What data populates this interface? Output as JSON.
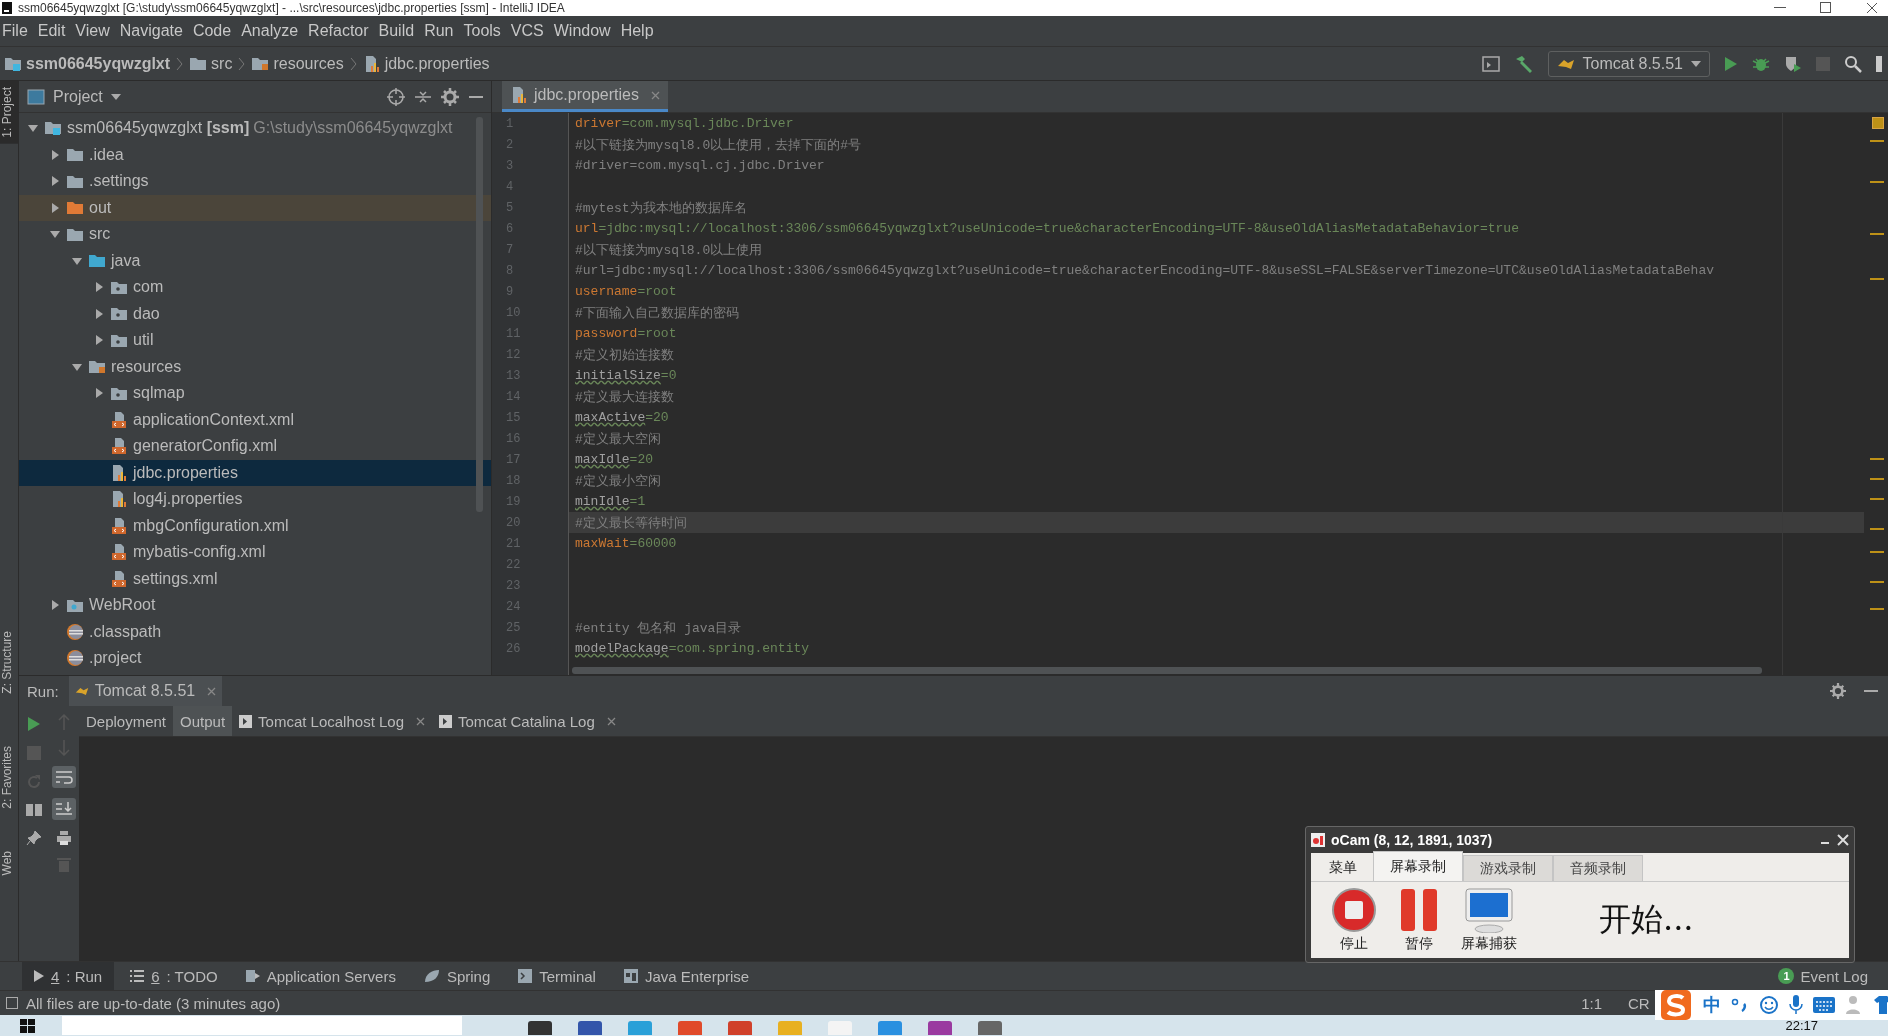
{
  "window": {
    "title": "ssm06645yqwzglxt [G:\\study\\ssm06645yqwzglxt] - ...\\src\\resources\\jdbc.properties [ssm] - IntelliJ IDEA"
  },
  "menu": [
    "File",
    "Edit",
    "View",
    "Navigate",
    "Code",
    "Analyze",
    "Refactor",
    "Build",
    "Run",
    "Tools",
    "VCS",
    "Window",
    "Help"
  ],
  "breadcrumb": [
    {
      "label": "ssm06645yqwzglxt",
      "kind": "module"
    },
    {
      "label": "src",
      "kind": "folder"
    },
    {
      "label": "resources",
      "kind": "resources"
    },
    {
      "label": "jdbc.properties",
      "kind": "properties"
    }
  ],
  "run_config": "Tomcat 8.5.51",
  "side_stripe": [
    {
      "label": "1: Project",
      "selected": true
    },
    {
      "label": "Z: Structure",
      "selected": false
    },
    {
      "label": "2: Favorites",
      "selected": false
    },
    {
      "label": "Web",
      "selected": false
    }
  ],
  "project": {
    "title": "Project",
    "tree": [
      {
        "name": "ssm06645yqwzglxt",
        "module": "[ssm]",
        "path": "G:\\study\\ssm06645yqwzglxt",
        "kind": "module",
        "expanded": true,
        "selected": false,
        "children": [
          {
            "name": ".idea",
            "kind": "folder",
            "expanded": false,
            "selected": false
          },
          {
            "name": ".settings",
            "kind": "folder",
            "expanded": false,
            "selected": false
          },
          {
            "name": "out",
            "kind": "excluded",
            "expanded": false,
            "selected": false
          },
          {
            "name": "src",
            "kind": "folder",
            "expanded": true,
            "selected": false,
            "children": [
              {
                "name": "java",
                "kind": "source",
                "expanded": true,
                "selected": false,
                "children": [
                  {
                    "name": "com",
                    "kind": "package",
                    "expanded": false,
                    "selected": false
                  },
                  {
                    "name": "dao",
                    "kind": "package",
                    "expanded": false,
                    "selected": false
                  },
                  {
                    "name": "util",
                    "kind": "package",
                    "expanded": false,
                    "selected": false
                  }
                ]
              },
              {
                "name": "resources",
                "kind": "resources",
                "expanded": true,
                "selected": false,
                "children": [
                  {
                    "name": "sqlmap",
                    "kind": "package",
                    "expanded": false,
                    "selected": false
                  },
                  {
                    "name": "applicationContext.xml",
                    "kind": "spring-xml",
                    "selected": false
                  },
                  {
                    "name": "generatorConfig.xml",
                    "kind": "xml",
                    "selected": false
                  },
                  {
                    "name": "jdbc.properties",
                    "kind": "properties",
                    "selected": true
                  },
                  {
                    "name": "log4j.properties",
                    "kind": "properties",
                    "selected": false
                  },
                  {
                    "name": "mbgConfiguration.xml",
                    "kind": "xml",
                    "selected": false
                  },
                  {
                    "name": "mybatis-config.xml",
                    "kind": "xml",
                    "selected": false
                  },
                  {
                    "name": "settings.xml",
                    "kind": "xml",
                    "selected": false
                  }
                ]
              }
            ]
          },
          {
            "name": "WebRoot",
            "kind": "web",
            "expanded": false,
            "selected": false
          },
          {
            "name": ".classpath",
            "kind": "eclipse",
            "selected": false
          },
          {
            "name": ".project",
            "kind": "eclipse",
            "selected": false
          }
        ]
      }
    ]
  },
  "editor": {
    "tab": "jdbc.properties",
    "lines": [
      {
        "n": "1",
        "kind": "property",
        "key": "driver",
        "value": "=com.mysql.jdbc.Driver",
        "unused": false,
        "current": false
      },
      {
        "n": "2",
        "kind": "comment",
        "text": "#以下链接为mysql8.0以上使用，去掉下面的#号",
        "current": false
      },
      {
        "n": "3",
        "kind": "comment",
        "text": "#driver=com.mysql.cj.jdbc.Driver",
        "current": false
      },
      {
        "n": "4",
        "kind": "blank",
        "current": false
      },
      {
        "n": "5",
        "kind": "comment",
        "text": "#mytest为我本地的数据库名",
        "current": false
      },
      {
        "n": "6",
        "kind": "property",
        "key": "url",
        "value": "=jdbc:mysql://localhost:3306/ssm06645yqwzglxt?useUnicode=true&characterEncoding=UTF-8&useOldAliasMetadataBehavior=true",
        "unused": false,
        "current": false
      },
      {
        "n": "7",
        "kind": "comment",
        "text": "#以下链接为mysql8.0以上使用",
        "current": false
      },
      {
        "n": "8",
        "kind": "comment",
        "text": "#url=jdbc:mysql://localhost:3306/ssm06645yqwzglxt?useUnicode=true&characterEncoding=UTF-8&useSSL=FALSE&serverTimezone=UTC&useOldAliasMetadataBehav",
        "current": false
      },
      {
        "n": "9",
        "kind": "property",
        "key": "username",
        "value": "=root",
        "unused": false,
        "current": false
      },
      {
        "n": "10",
        "kind": "comment",
        "text": "#下面输入自己数据库的密码",
        "current": false
      },
      {
        "n": "11",
        "kind": "property",
        "key": "password",
        "value": "=root",
        "unused": false,
        "current": false
      },
      {
        "n": "12",
        "kind": "comment",
        "text": "#定义初始连接数",
        "current": false
      },
      {
        "n": "13",
        "kind": "property",
        "key": "initialSize",
        "value": "=0",
        "unused": true,
        "current": false
      },
      {
        "n": "14",
        "kind": "comment",
        "text": "#定义最大连接数",
        "current": false
      },
      {
        "n": "15",
        "kind": "property",
        "key": "maxActive",
        "value": "=20",
        "unused": true,
        "current": false
      },
      {
        "n": "16",
        "kind": "comment",
        "text": "#定义最大空闲",
        "current": false
      },
      {
        "n": "17",
        "kind": "property",
        "key": "maxIdle",
        "value": "=20",
        "unused": true,
        "current": false
      },
      {
        "n": "18",
        "kind": "comment",
        "text": "#定义最小空闲",
        "current": false
      },
      {
        "n": "19",
        "kind": "property",
        "key": "minIdle",
        "value": "=1",
        "unused": true,
        "current": false
      },
      {
        "n": "20",
        "kind": "comment",
        "text": "#定义最长等待时间",
        "current": true
      },
      {
        "n": "21",
        "kind": "property",
        "key": "maxWait",
        "value": "=60000",
        "unused": false,
        "current": false
      },
      {
        "n": "22",
        "kind": "blank",
        "current": false
      },
      {
        "n": "23",
        "kind": "blank",
        "current": false
      },
      {
        "n": "24",
        "kind": "blank",
        "current": false
      },
      {
        "n": "25",
        "kind": "comment",
        "text": "#entity 包名和 java目录",
        "current": false
      },
      {
        "n": "26",
        "kind": "property",
        "key": "modelPackage",
        "value": "=com.spring.entity",
        "unused": true,
        "current": false
      }
    ]
  },
  "run_panel": {
    "label": "Run:",
    "config_tab": "Tomcat 8.5.51",
    "tabs": [
      {
        "label": "Deployment",
        "kind": "plain",
        "selected": false
      },
      {
        "label": "Output",
        "kind": "plain",
        "selected": true
      },
      {
        "label": "Tomcat Localhost Log",
        "kind": "log",
        "selected": false
      },
      {
        "label": "Tomcat Catalina Log",
        "kind": "log",
        "selected": false
      }
    ]
  },
  "tool_windows": [
    {
      "key": "4",
      "label": ": Run",
      "kind": "run",
      "selected": true
    },
    {
      "key": "6",
      "label": ": TODO",
      "kind": "todo",
      "selected": false
    },
    {
      "label": "Application Servers",
      "kind": "servers",
      "selected": false
    },
    {
      "label": "Spring",
      "kind": "spring",
      "selected": false
    },
    {
      "label": "Terminal",
      "kind": "terminal",
      "selected": false
    },
    {
      "label": "Java Enterprise",
      "kind": "javaee",
      "selected": false
    }
  ],
  "event_log": {
    "count": "1",
    "label": "Event Log"
  },
  "status_bar": {
    "message": "All files are up-to-date (3 minutes ago)",
    "position": "1:1",
    "line_separator": "CR"
  },
  "ocam": {
    "title": "oCam (8, 12, 1891, 1037)",
    "tabs": [
      {
        "label": "菜单",
        "selected": false
      },
      {
        "label": "屏幕录制",
        "selected": true
      },
      {
        "label": "游戏录制",
        "selected": false
      },
      {
        "label": "音频录制",
        "selected": false
      }
    ],
    "buttons": [
      {
        "label": "停止",
        "kind": "stop"
      },
      {
        "label": "暂停",
        "kind": "pause"
      },
      {
        "label": "屏幕捕获",
        "kind": "capture"
      }
    ],
    "status": "开始..."
  },
  "ime_bar": {
    "mode": "中"
  },
  "taskbar": {
    "time": "22:17"
  }
}
